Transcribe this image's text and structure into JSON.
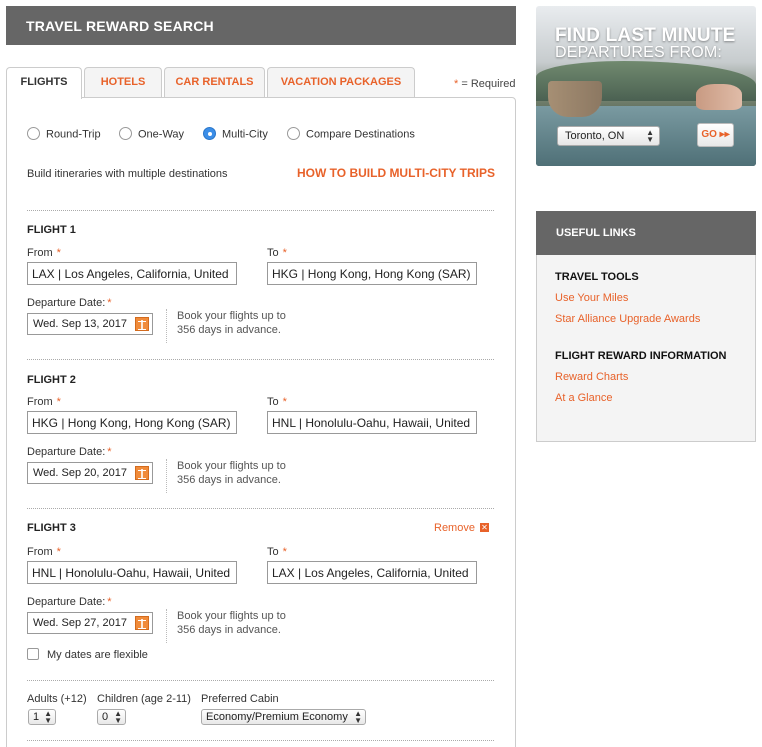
{
  "header": {
    "title": "TRAVEL REWARD SEARCH"
  },
  "tabs": [
    {
      "label": "FLIGHTS"
    },
    {
      "label": "HOTELS"
    },
    {
      "label": "CAR RENTALS"
    },
    {
      "label": "VACATION PACKAGES"
    }
  ],
  "required_note": {
    "star": "*",
    "text": "= Required"
  },
  "trip_types": [
    {
      "label": "Round-Trip",
      "selected": false
    },
    {
      "label": "One-Way",
      "selected": false
    },
    {
      "label": "Multi-City",
      "selected": true
    },
    {
      "label": "Compare Destinations",
      "selected": false
    }
  ],
  "intro_text": "Build itineraries with multiple destinations",
  "howto_link": "HOW TO BUILD MULTI-CITY TRIPS",
  "labels": {
    "from": "From",
    "to": "To",
    "departure_date": "Departure Date:",
    "required_star": "*",
    "remove": "Remove",
    "remove_x": "✕"
  },
  "advance_note": {
    "line1": "Book your flights up to",
    "line2": "356 days in advance."
  },
  "flights": [
    {
      "title": "FLIGHT 1",
      "from": "LAX | Los Angeles, California, United",
      "to": "HKG | Hong Kong, Hong Kong (SAR)",
      "date": "Wed. Sep 13, 2017"
    },
    {
      "title": "FLIGHT 2",
      "from": "HKG | Hong Kong, Hong Kong (SAR)",
      "to": "HNL | Honolulu-Oahu, Hawaii, United",
      "date": "Wed. Sep 20, 2017"
    },
    {
      "title": "FLIGHT 3",
      "from": "HNL | Honolulu-Oahu, Hawaii, United",
      "to": "LAX | Los Angeles, California, United",
      "date": "Wed. Sep 27, 2017"
    }
  ],
  "flexible_label": "My dates are flexible",
  "passengers": {
    "adults_label": "Adults (+12)",
    "adults_value": "1",
    "children_label": "Children (age 2-11)",
    "children_value": "0",
    "cabin_label": "Preferred Cabin",
    "cabin_value": "Economy/Premium Economy"
  },
  "promo": {
    "line1": "FIND LAST MINUTE",
    "line2": "DEPARTURES FROM:",
    "city": "Toronto, ON",
    "go": "GO ▸▸"
  },
  "useful_links": {
    "title": "USEFUL LINKS",
    "sections": [
      {
        "heading": "TRAVEL TOOLS",
        "links": [
          "Use Your Miles",
          "Star Alliance Upgrade Awards"
        ]
      },
      {
        "heading": "FLIGHT REWARD INFORMATION",
        "links": [
          "Reward Charts",
          "At a Glance"
        ]
      }
    ]
  }
}
